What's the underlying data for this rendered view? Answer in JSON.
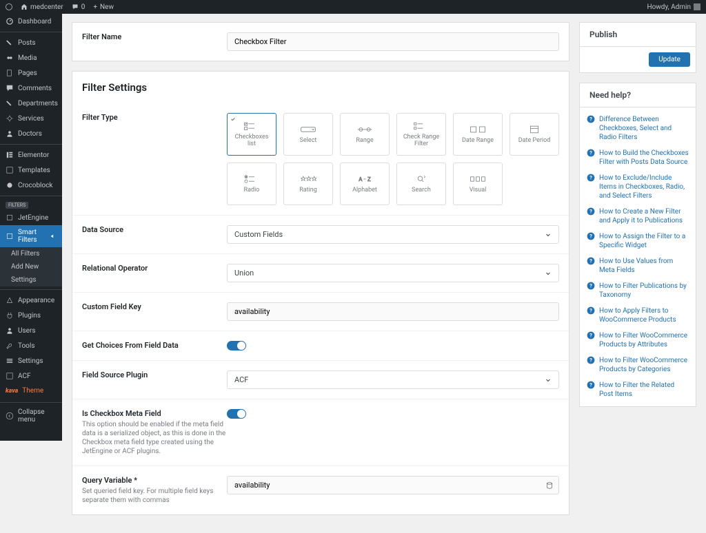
{
  "topbar": {
    "site": "medcenter",
    "comments": "0",
    "new": "New",
    "greeting": "Howdy, Admin"
  },
  "sidebar": {
    "items": [
      {
        "label": "Dashboard"
      },
      {
        "label": "Posts"
      },
      {
        "label": "Media"
      },
      {
        "label": "Pages"
      },
      {
        "label": "Comments"
      },
      {
        "label": "Departments"
      },
      {
        "label": "Services"
      },
      {
        "label": "Doctors"
      },
      {
        "label": "Elementor"
      },
      {
        "label": "Templates"
      },
      {
        "label": "Crocoblock"
      },
      {
        "label": "JetEngine"
      },
      {
        "label": "Smart Filters"
      },
      {
        "label": "Appearance"
      },
      {
        "label": "Plugins"
      },
      {
        "label": "Users"
      },
      {
        "label": "Tools"
      },
      {
        "label": "Settings"
      },
      {
        "label": "ACF"
      },
      {
        "label": "Theme"
      }
    ],
    "tag": "FILTERS",
    "submenu": [
      "All Filters",
      "Add New",
      "Settings"
    ],
    "collapse": "Collapse menu"
  },
  "filterName": {
    "label": "Filter Name",
    "value": "Checkbox Filter"
  },
  "settingsTitle": "Filter Settings",
  "filterType": {
    "label": "Filter Type",
    "options": [
      "Checkboxes list",
      "Select",
      "Range",
      "Check Range Filter",
      "Date Range",
      "Date Period",
      "Radio",
      "Rating",
      "Alphabet",
      "Search",
      "Visual"
    ]
  },
  "dataSource": {
    "label": "Data Source",
    "value": "Custom Fields"
  },
  "relOp": {
    "label": "Relational Operator",
    "value": "Union"
  },
  "customKey": {
    "label": "Custom Field Key",
    "value": "availability"
  },
  "getChoices": {
    "label": "Get Choices From Field Data"
  },
  "fieldSource": {
    "label": "Field Source Plugin",
    "value": "ACF"
  },
  "isCheckbox": {
    "label": "Is Checkbox Meta Field",
    "desc": "This option should be enabled if the meta field data is a serialized object, as this is done in the Checkbox meta field type created using the JetEngine or ACF plugins."
  },
  "queryVar": {
    "label": "Query Variable *",
    "desc": "Set queried field key. For multiple field keys separate them with commas",
    "value": "availability"
  },
  "publish": {
    "title": "Publish",
    "button": "Update"
  },
  "help": {
    "title": "Need help?",
    "items": [
      "Difference Between Checkboxes, Select and Radio Filters",
      "How to Build the Checkboxes Filter with Posts Data Source",
      "How to Exclude/Include Items in Checkboxes, Radio, and Select Filters",
      "How to Create a New Filter and Apply it to Publications",
      "How to Assign the Filter to a Specific Widget",
      "How to Use Values from Meta Fields",
      "How to Filter Publications by Taxonomy",
      "How to Apply Filters to WooCommerce Products",
      "How to Filter WooCommerce Products by Attributes",
      "How to Filter WooCommerce Products by Categories",
      "How to Filter the Related Post Items"
    ]
  }
}
